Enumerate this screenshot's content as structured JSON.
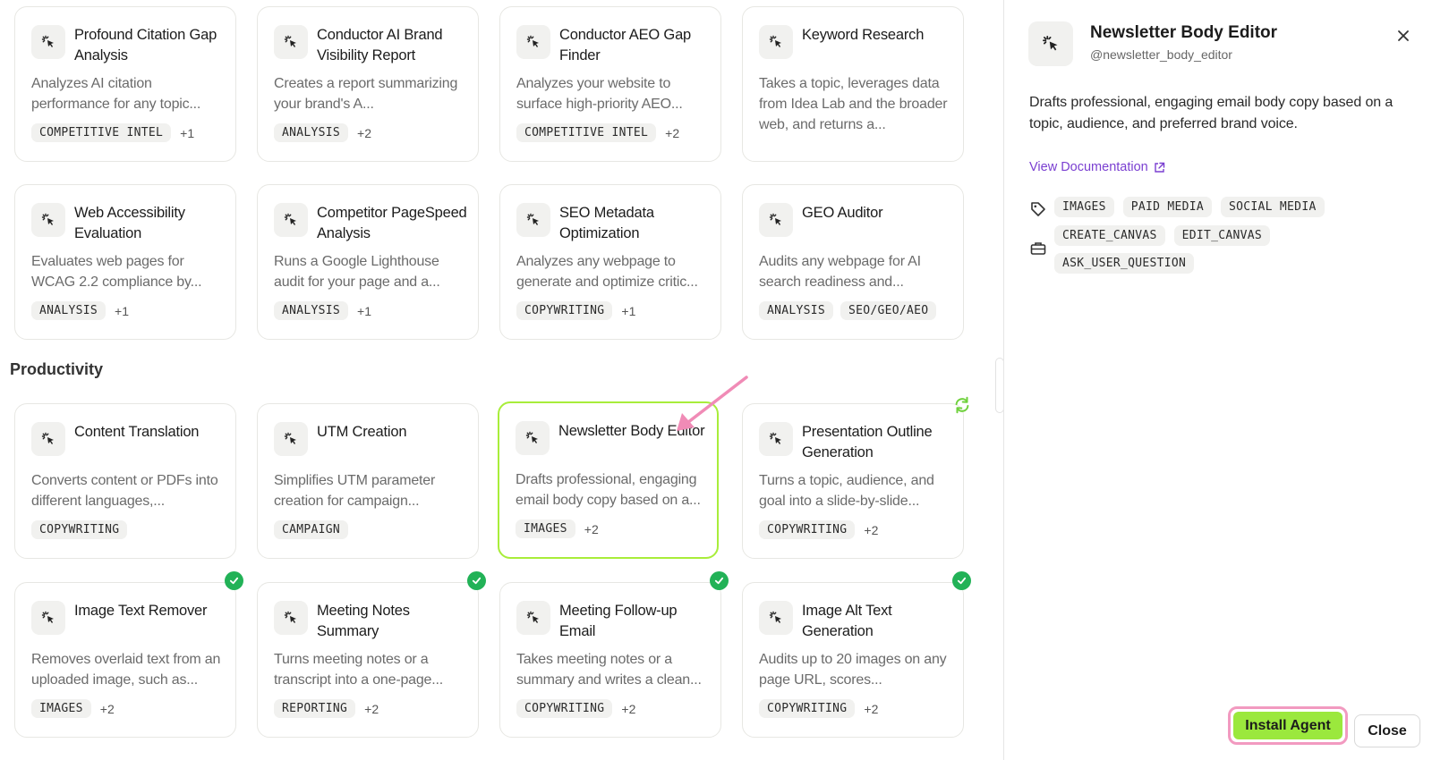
{
  "cards_row1": [
    {
      "title": "Profound Citation Gap Analysis",
      "desc": "Analyzes AI citation performance for any topic...",
      "tags": [
        "COMPETITIVE INTEL"
      ],
      "more": "+1"
    },
    {
      "title": "Conductor AI Brand Visibility Report",
      "desc": "Creates a report summarizing your brand's A...",
      "tags": [
        "ANALYSIS"
      ],
      "more": "+2"
    },
    {
      "title": "Conductor AEO Gap Finder",
      "desc": "Analyzes your website to surface high-priority AEO...",
      "tags": [
        "COMPETITIVE INTEL"
      ],
      "more": "+2"
    },
    {
      "title": "Keyword Research",
      "desc": "Takes a topic, leverages data from Idea Lab and the broader web, and returns a...",
      "tags": [],
      "more": ""
    }
  ],
  "cards_row2": [
    {
      "title": "Web Accessibility Evaluation",
      "desc": "Evaluates web pages for WCAG 2.2 compliance by...",
      "tags": [
        "ANALYSIS"
      ],
      "more": "+1"
    },
    {
      "title": "Competitor PageSpeed Analysis",
      "desc": "Runs a Google Lighthouse audit for your page and a...",
      "tags": [
        "ANALYSIS"
      ],
      "more": "+1"
    },
    {
      "title": "SEO Metadata Optimization",
      "desc": "Analyzes any webpage to generate and optimize critic...",
      "tags": [
        "COPYWRITING"
      ],
      "more": "+1"
    },
    {
      "title": "GEO Auditor",
      "desc": "Audits any webpage for AI search readiness and...",
      "tags": [
        "ANALYSIS",
        "SEO/GEO/AEO"
      ],
      "more": ""
    }
  ],
  "section_title": "Productivity",
  "cards_row3": [
    {
      "title": "Content Translation",
      "desc": "Converts content or PDFs into different languages,...",
      "tags": [
        "COPYWRITING"
      ],
      "more": ""
    },
    {
      "title": "UTM Creation",
      "desc": "Simplifies UTM parameter creation for campaign...",
      "tags": [
        "CAMPAIGN"
      ],
      "more": ""
    },
    {
      "title": "Newsletter Body Editor",
      "desc": "Drafts professional, engaging email body copy based on a...",
      "tags": [
        "IMAGES"
      ],
      "more": "+2"
    },
    {
      "title": "Presentation Outline Generation",
      "desc": "Turns a topic, audience, and goal into a slide-by-slide...",
      "tags": [
        "COPYWRITING"
      ],
      "more": "+2"
    }
  ],
  "cards_row4": [
    {
      "title": "Image Text Remover",
      "desc": "Removes overlaid text from an uploaded image, such as...",
      "tags": [
        "IMAGES"
      ],
      "more": "+2"
    },
    {
      "title": "Meeting Notes Summary",
      "desc": "Turns meeting notes or a transcript into a one-page...",
      "tags": [
        "REPORTING"
      ],
      "more": "+2"
    },
    {
      "title": "Meeting Follow-up Email",
      "desc": "Takes meeting notes or a summary and writes a clean...",
      "tags": [
        "COPYWRITING"
      ],
      "more": "+2"
    },
    {
      "title": "Image Alt Text Generation",
      "desc": "Audits up to 20 images on any page URL, scores...",
      "tags": [
        "COPYWRITING"
      ],
      "more": "+2"
    }
  ],
  "panel": {
    "title": "Newsletter Body Editor",
    "handle": "@newsletter_body_editor",
    "description": "Drafts professional, engaging email body copy based on a topic, audience, and preferred brand voice.",
    "doc_link": "View Documentation",
    "tags": [
      "IMAGES",
      "PAID MEDIA",
      "SOCIAL MEDIA"
    ],
    "tools": [
      "CREATE_CANVAS",
      "EDIT_CANVAS",
      "ASK_USER_QUESTION"
    ],
    "install_label": "Install Agent",
    "close_label": "Close"
  },
  "colors": {
    "accent_green": "#9be83d",
    "selected_border": "#a8ed3a",
    "highlight_pink": "#f29ac0",
    "check_green": "#22b257",
    "link_purple": "#7a3fd1"
  }
}
